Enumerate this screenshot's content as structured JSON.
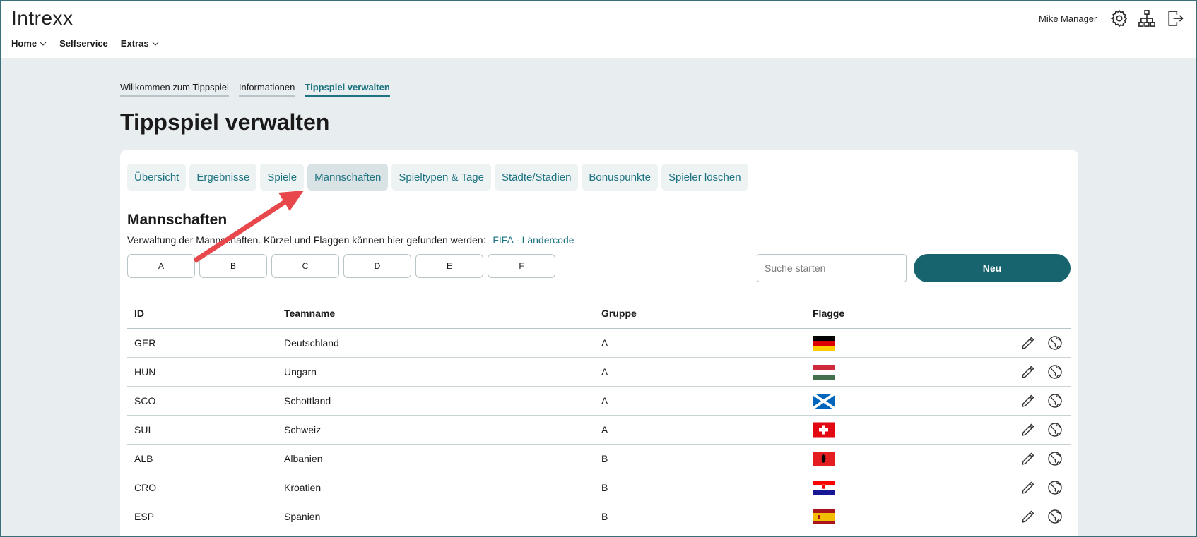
{
  "header": {
    "logo": "Intrexx",
    "user_name": "Mike Manager",
    "nav": [
      {
        "label": "Home",
        "has_dropdown": true
      },
      {
        "label": "Selfservice",
        "has_dropdown": false
      },
      {
        "label": "Extras",
        "has_dropdown": true
      }
    ]
  },
  "subnav": {
    "items": [
      {
        "label": "Willkommen zum Tippspiel",
        "active": false
      },
      {
        "label": "Informationen",
        "active": false
      },
      {
        "label": "Tippspiel verwalten",
        "active": true
      }
    ]
  },
  "page_title": "Tippspiel verwalten",
  "tabs": [
    {
      "label": "Übersicht",
      "active": false
    },
    {
      "label": "Ergebnisse",
      "active": false
    },
    {
      "label": "Spiele",
      "active": false
    },
    {
      "label": "Mannschaften",
      "active": true
    },
    {
      "label": "Spieltypen & Tage",
      "active": false
    },
    {
      "label": "Städte/Stadien",
      "active": false
    },
    {
      "label": "Bonuspunkte",
      "active": false
    },
    {
      "label": "Spieler löschen",
      "active": false
    }
  ],
  "section": {
    "title": "Mannschaften",
    "description": "Verwaltung der Mannschaften. Kürzel und Flaggen können hier gefunden werden:",
    "link_label": "FIFA - Ländercode"
  },
  "group_buttons": [
    "A",
    "B",
    "C",
    "D",
    "E",
    "F"
  ],
  "search": {
    "placeholder": "Suche starten",
    "value": ""
  },
  "new_button": "Neu",
  "table": {
    "columns": [
      "ID",
      "Teamname",
      "Gruppe",
      "Flagge"
    ],
    "rows": [
      {
        "id": "GER",
        "name": "Deutschland",
        "group": "A",
        "flag": "germany"
      },
      {
        "id": "HUN",
        "name": "Ungarn",
        "group": "A",
        "flag": "hungary"
      },
      {
        "id": "SCO",
        "name": "Schottland",
        "group": "A",
        "flag": "scotland"
      },
      {
        "id": "SUI",
        "name": "Schweiz",
        "group": "A",
        "flag": "switzerland"
      },
      {
        "id": "ALB",
        "name": "Albanien",
        "group": "B",
        "flag": "albania"
      },
      {
        "id": "CRO",
        "name": "Kroatien",
        "group": "B",
        "flag": "croatia"
      },
      {
        "id": "ESP",
        "name": "Spanien",
        "group": "B",
        "flag": "spain"
      }
    ]
  },
  "colors": {
    "accent": "#1d7380",
    "button": "#17646f",
    "annotation_arrow": "#e8474b"
  },
  "icons": {
    "header": [
      "gear-icon",
      "sitemap-icon",
      "logout-icon"
    ],
    "row_actions": [
      "edit-pencil-icon",
      "globe-icon"
    ]
  }
}
